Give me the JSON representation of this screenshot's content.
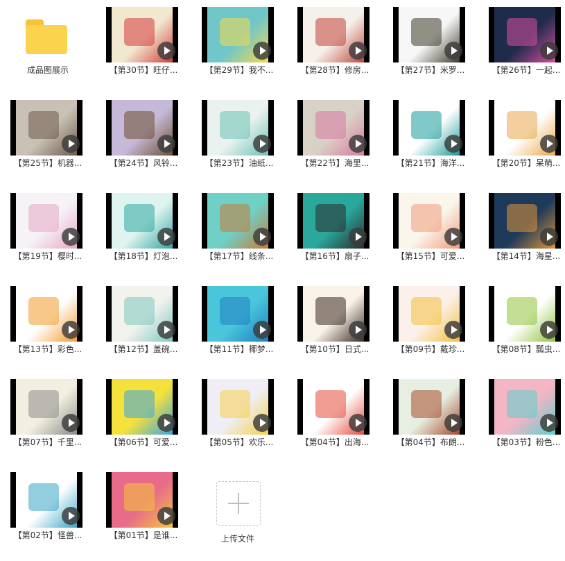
{
  "folder": {
    "label": "成品图展示",
    "icon": "folder-icon",
    "color": "#fcd34d"
  },
  "upload": {
    "label": "上传文件",
    "icon": "plus-icon"
  },
  "items": [
    {
      "label": "【第30节】旺仔...",
      "c1": "#f2e8d0",
      "c2": "#d33b3b"
    },
    {
      "label": "【第29节】我不...",
      "c1": "#6fc7c9",
      "c2": "#f6d84b"
    },
    {
      "label": "【第28节】修房...",
      "c1": "#f5f0ea",
      "c2": "#c0463b"
    },
    {
      "label": "【第27节】米罗...",
      "c1": "#f7f7f7",
      "c2": "#3e3a2a"
    },
    {
      "label": "【第26节】一起...",
      "c1": "#1e2b4a",
      "c2": "#d94ea0"
    },
    {
      "label": "【第25节】机器...",
      "c1": "#c9c1b6",
      "c2": "#6d5a4a"
    },
    {
      "label": "【第24节】风铃...",
      "c1": "#c6b8d8",
      "c2": "#6b5032"
    },
    {
      "label": "【第23节】油纸...",
      "c1": "#e9f2ee",
      "c2": "#6cc2b6"
    },
    {
      "label": "【第22节】海里...",
      "c1": "#d8d1c6",
      "c2": "#d97aa0"
    },
    {
      "label": "【第21节】海洋...",
      "c1": "#ffffff",
      "c2": "#1a9b9b"
    },
    {
      "label": "【第20节】呆萌...",
      "c1": "#ffffff",
      "c2": "#e8a84b"
    },
    {
      "label": "【第19节】樱时...",
      "c1": "#f6f3f7",
      "c2": "#e5a7c4"
    },
    {
      "label": "【第18节】灯泡...",
      "c1": "#dff3ef",
      "c2": "#2ea7a0"
    },
    {
      "label": "【第17节】线条...",
      "c1": "#6fd0c6",
      "c2": "#c97a3a"
    },
    {
      "label": "【第16节】扇子...",
      "c1": "#2aa89c",
      "c2": "#2b2b2b"
    },
    {
      "label": "【第15节】可爱...",
      "c1": "#fbf6ec",
      "c2": "#f19b7b"
    },
    {
      "label": "【第14节】海星...",
      "c1": "#1e3a5a",
      "c2": "#e0963a"
    },
    {
      "label": "【第13节】彩色...",
      "c1": "#ffffff",
      "c2": "#f39a2b"
    },
    {
      "label": "【第12节】盖碗...",
      "c1": "#f3f3ee",
      "c2": "#7cc7bf"
    },
    {
      "label": "【第11节】椰梦...",
      "c1": "#4ac6dc",
      "c2": "#1f7fc1"
    },
    {
      "label": "【第10节】日式...",
      "c1": "#faf3ea",
      "c2": "#3a2a20"
    },
    {
      "label": "【第09节】戴珍...",
      "c1": "#fcf0ea",
      "c2": "#f2c03b"
    },
    {
      "label": "【第08节】瓢虫...",
      "c1": "#ffffff",
      "c2": "#8fc23b"
    },
    {
      "label": "【第07节】千里...",
      "c1": "#f3efe0",
      "c2": "#8a8a8a"
    },
    {
      "label": "【第06节】可爱...",
      "c1": "#f5e13b",
      "c2": "#3aa6e0"
    },
    {
      "label": "【第05节】欢乐...",
      "c1": "#efeef5",
      "c2": "#f6d04b"
    },
    {
      "label": "【第04节】出海...",
      "c1": "#ffffff",
      "c2": "#e64a3b"
    },
    {
      "label": "【第04节】布朗...",
      "c1": "#e7efe2",
      "c2": "#a54a2a"
    },
    {
      "label": "【第03节】粉色...",
      "c1": "#f2b6c4",
      "c2": "#5ad0d0"
    },
    {
      "label": "【第02节】怪兽...",
      "c1": "#ffffff",
      "c2": "#3aa6c7"
    },
    {
      "label": "【第01节】是谁...",
      "c1": "#e86b8a",
      "c2": "#f4c63b"
    }
  ]
}
